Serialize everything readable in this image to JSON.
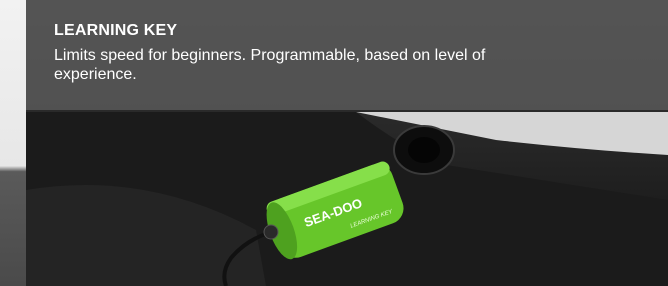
{
  "caption": {
    "title": "LEARNING KEY",
    "text": "Limits speed for beginners. Programmable, based on level of experience."
  },
  "image": {
    "subject": "green-key-fob-photo",
    "brand_mark": "SEA-DOO",
    "key_subtext": "LEARNING KEY",
    "accent_color": "#67c62a"
  }
}
